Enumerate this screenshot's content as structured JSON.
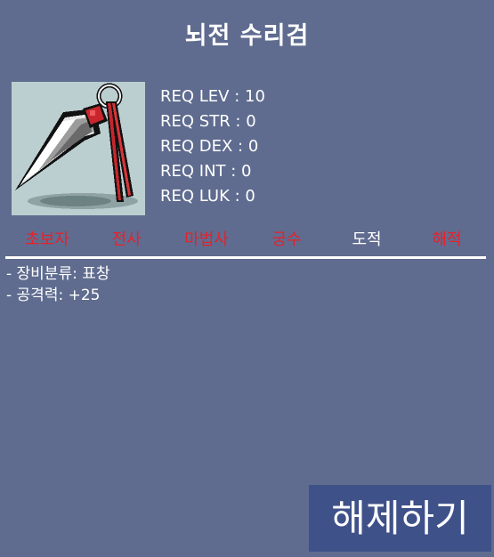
{
  "item": {
    "name": "뇌전 수리검",
    "icon": "thunder-shuriken-throwing-star-icon"
  },
  "requirements": [
    "REQ LEV : 10",
    "REQ STR : 0",
    "REQ DEX : 0",
    "REQ INT : 0",
    "REQ LUK : 0"
  ],
  "jobs": [
    {
      "label": "초보자",
      "color": "#e8202a"
    },
    {
      "label": "전사",
      "color": "#e8202a"
    },
    {
      "label": "마법사",
      "color": "#e8202a"
    },
    {
      "label": "궁수",
      "color": "#e8202a"
    },
    {
      "label": "도적",
      "color": "#ffffff"
    },
    {
      "label": "해적",
      "color": "#e8202a"
    }
  ],
  "stats": [
    "- 장비분류: 표창",
    "- 공격력: +25"
  ],
  "actions": {
    "unequip_label": "해제하기"
  },
  "colors": {
    "background": "#5f6c8f",
    "button": "#3f5189",
    "restricted_job": "#e8202a",
    "allowed_job": "#ffffff"
  }
}
